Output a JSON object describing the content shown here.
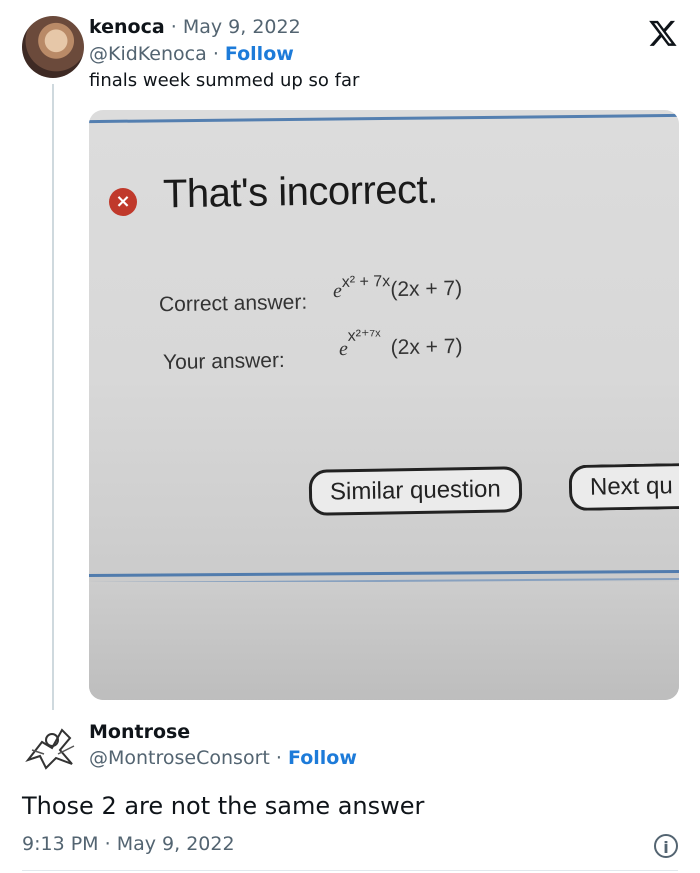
{
  "tweet": {
    "author_name": "kenoca",
    "separator": "·",
    "date": "May 9, 2022",
    "handle": "@KidKenoca",
    "follow_label": "Follow",
    "text": "finals week summed up so far"
  },
  "photo": {
    "headline": "That's incorrect.",
    "correct_label": "Correct answer:",
    "your_label": "Your answer:",
    "correct_answer": {
      "base": "e",
      "exponent": "x² + 7x",
      "factor": "(2x + 7)"
    },
    "your_answer": {
      "base": "e",
      "exponent": "x²⁺⁷ˣ",
      "factor": "(2x + 7)"
    },
    "similar_button": "Similar question",
    "next_button": "Next qu"
  },
  "reply": {
    "author_name": "Montrose",
    "handle": "@MontroseConsort",
    "separator": "·",
    "follow_label": "Follow",
    "text": "Those 2 are not the same answer",
    "time": "9:13 PM",
    "date": "May 9, 2022"
  },
  "icons": {
    "x_logo": "x-logo-icon",
    "info": "info-icon",
    "error": "error-x-icon"
  },
  "colors": {
    "link": "#1d7bd9",
    "muted": "#536471",
    "error": "#c0392b"
  }
}
